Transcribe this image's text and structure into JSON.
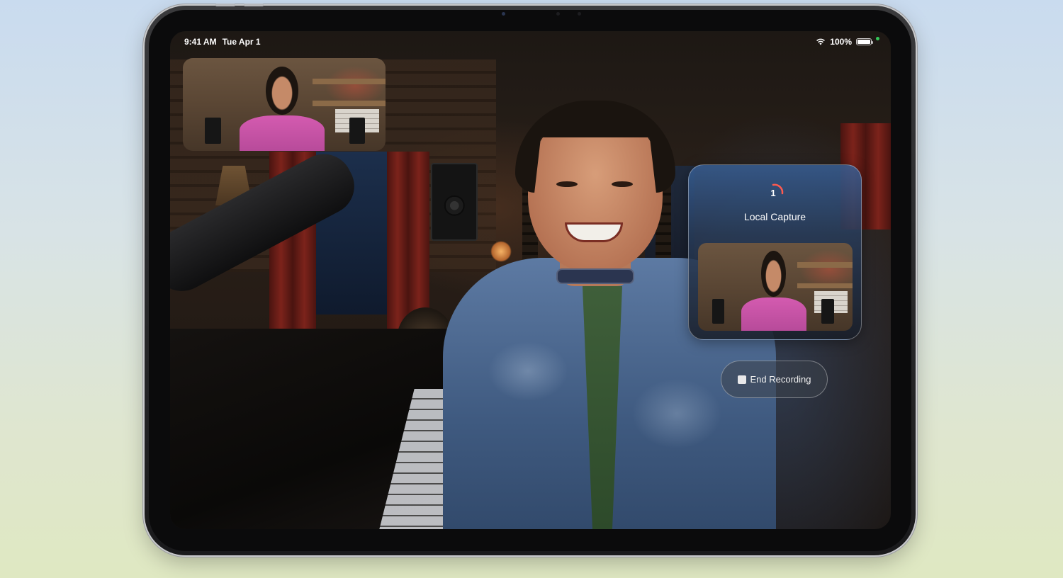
{
  "status_bar": {
    "time": "9:41 AM",
    "date": "Tue Apr 1",
    "battery": "100%",
    "battery_level": 1.0,
    "wifi_icon": "wifi-icon",
    "camera_indicator_color": "#34c759"
  },
  "local_capture": {
    "countdown": "1",
    "title": "Local Capture",
    "progress_color": "#ff5a4f"
  },
  "controls": {
    "end_recording_label": "End Recording",
    "stop_icon": "stop-square-icon"
  }
}
